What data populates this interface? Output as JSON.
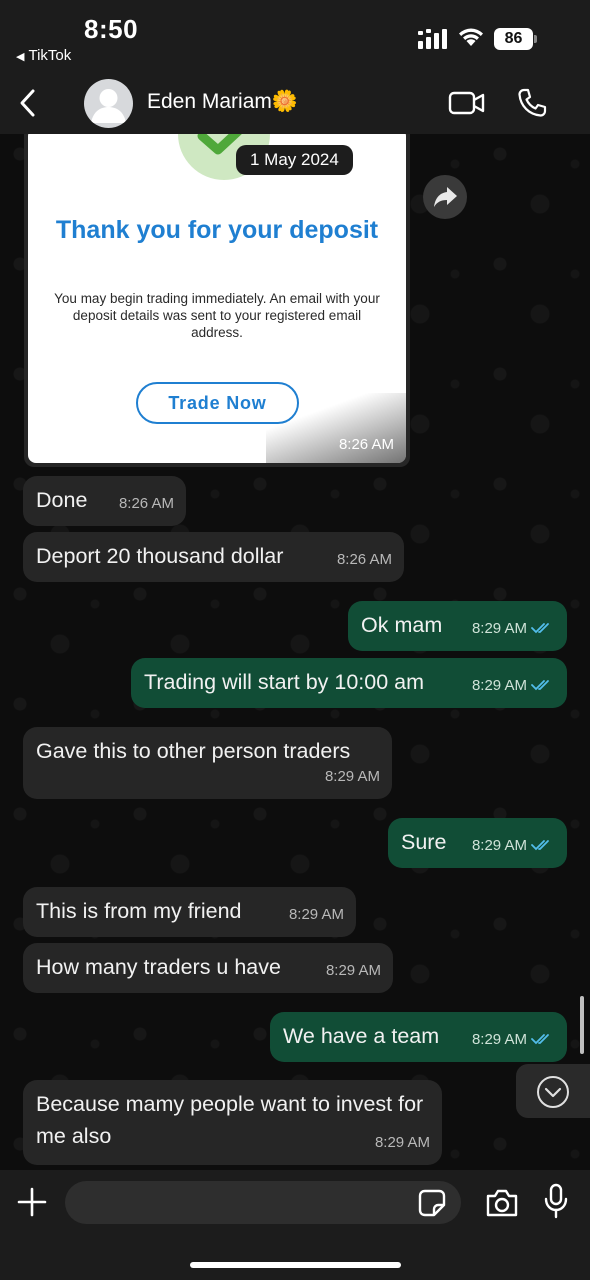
{
  "status_bar": {
    "time": "8:50",
    "back_app": "TikTok",
    "battery": "86"
  },
  "header": {
    "contact_name": "Eden Mariam🌼"
  },
  "image_message": {
    "date_badge": "1 May 2024",
    "title": "Thank you for your deposit",
    "body": "You may begin trading immediately. An email with your deposit details was sent to your registered email address.",
    "button_label": "Trade Now",
    "time": "8:26 AM"
  },
  "messages": [
    {
      "text": "Done",
      "time": "8:26 AM",
      "dir": "in"
    },
    {
      "text": "Deport 20 thousand dollar",
      "time": "8:26 AM",
      "dir": "in"
    },
    {
      "text": "Ok mam",
      "time": "8:29 AM",
      "dir": "out"
    },
    {
      "text": "Trading will start by 10:00 am",
      "time": "8:29 AM",
      "dir": "out"
    },
    {
      "text": "Gave this to other person traders",
      "time": "8:29 AM",
      "dir": "in"
    },
    {
      "text": "Sure",
      "time": "8:29 AM",
      "dir": "out"
    },
    {
      "text": "This is from my friend",
      "time": "8:29 AM",
      "dir": "in"
    },
    {
      "text": "How many traders u have",
      "time": "8:29 AM",
      "dir": "in"
    },
    {
      "text": "We have a team",
      "time": "8:29 AM",
      "dir": "out"
    },
    {
      "text": "Because mamy people want to invest for me also",
      "time": "8:29 AM",
      "dir": "in"
    }
  ],
  "input": {
    "value": "",
    "placeholder": ""
  },
  "colors": {
    "incoming_bubble": "#262626",
    "outgoing_bubble": "#114d36",
    "read_ticks": "#53bdeb",
    "receipt_accent": "#1f7fd1"
  }
}
